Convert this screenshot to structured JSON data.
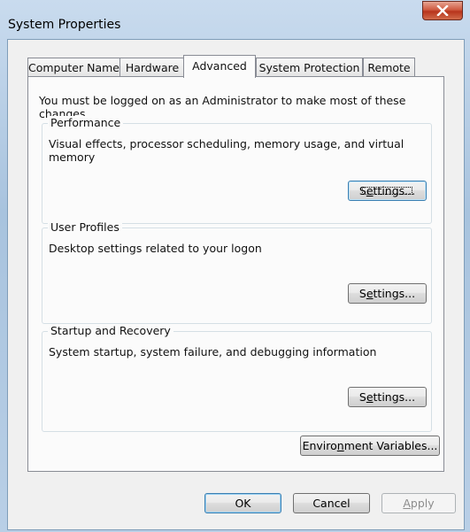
{
  "window": {
    "title": "System Properties",
    "close_icon": "close-icon"
  },
  "tabs": [
    {
      "label": "Computer Name",
      "active": false
    },
    {
      "label": "Hardware",
      "active": false
    },
    {
      "label": "Advanced",
      "active": true
    },
    {
      "label": "System Protection",
      "active": false
    },
    {
      "label": "Remote",
      "active": false
    }
  ],
  "admin_note": "You must be logged on as an Administrator to make most of these changes.",
  "performance": {
    "legend": "Performance",
    "description": "Visual effects, processor scheduling, memory usage, and virtual memory",
    "button_pre": "S",
    "button_acc": "e",
    "button_post": "ttings..."
  },
  "user_profiles": {
    "legend": "User Profiles",
    "description": "Desktop settings related to your logon",
    "button_pre": "S",
    "button_acc": "e",
    "button_post": "ttings..."
  },
  "startup_recovery": {
    "legend": "Startup and Recovery",
    "description": "System startup, system failure, and debugging information",
    "button_pre": "S",
    "button_acc": "e",
    "button_post": "ttings..."
  },
  "env_button": {
    "pre": "Enviro",
    "acc": "n",
    "post": "ment Variables..."
  },
  "footer": {
    "ok": "OK",
    "cancel": "Cancel",
    "apply_acc": "A",
    "apply_post": "pply"
  }
}
